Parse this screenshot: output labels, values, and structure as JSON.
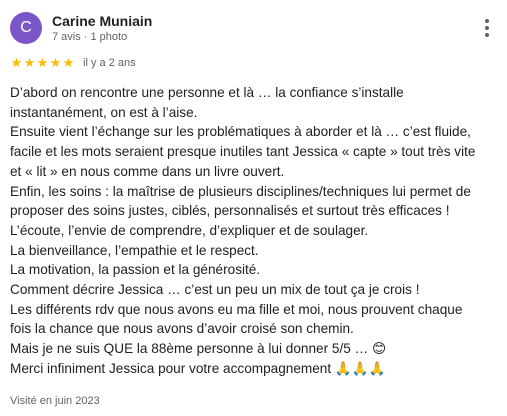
{
  "author": {
    "initial": "C",
    "name": "Carine Muniain",
    "meta": "7 avis · 1 photo",
    "avatar_color": "#7b56c9"
  },
  "menu": {
    "icon": "more-vert-icon"
  },
  "rating": {
    "stars": 5,
    "max": 5,
    "icon": "star-icon",
    "color": "#fbbc04",
    "relative_date": "il y a 2 ans"
  },
  "review": {
    "lines": [
      "D’abord on rencontre une personne et là … la confiance s’installe",
      "instantanément, on est à l’aise.",
      "Ensuite vient l’échange sur les problématiques à aborder et là … c’est fluide,",
      "facile et les mots seraient presque inutiles tant Jessica « capte » tout très vite",
      "et « lit » en nous comme dans un livre ouvert.",
      "Enfin, les soins : la maîtrise de plusieurs disciplines/techniques lui permet de",
      "proposer des soins justes, ciblés, personnalisés et surtout très efficaces !",
      "L’écoute, l’envie de comprendre, d’expliquer et de soulager.",
      "La bienveillance, l’empathie et le respect.",
      "La motivation, la passion et la générosité.",
      "Comment décrire Jessica … c’est un peu un mix de tout ça je crois !",
      "Les différents rdv que nous avons eu ma fille et moi, nous prouvent chaque",
      "fois la chance que nous avons d’avoir croisé son chemin.",
      "Mais je ne suis QUE la 88ème personne à lui donner 5/5 … 😊",
      "Merci infiniment Jessica pour votre accompagnement 🙏🙏🙏"
    ]
  },
  "visit": "Visité en juin 2023"
}
